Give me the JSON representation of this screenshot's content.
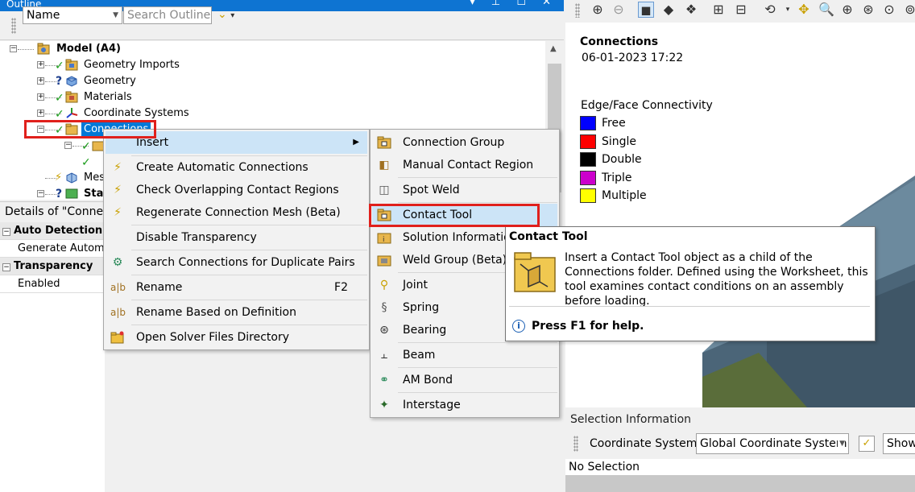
{
  "outline": {
    "title": "Outline",
    "window_buttons": "▾ ⊥ ☐ ✕",
    "name_filter": "Name",
    "search_placeholder": "Search Outline",
    "tree": {
      "model": "Model (A4)",
      "geometry_imports": "Geometry Imports",
      "geometry": "Geometry",
      "materials": "Materials",
      "coordinate_systems": "Coordinate Systems",
      "connections": "Connections",
      "mesh": "Mes",
      "static": "Sta"
    }
  },
  "details": {
    "title": "Details of \"Connec",
    "rows": {
      "auto_detection": "Auto Detection",
      "generate": "Generate Autom",
      "transparency": "Transparency",
      "enabled": "Enabled"
    }
  },
  "context_menu": {
    "insert": "Insert",
    "create_auto": "Create Automatic Connections",
    "check_overlap": "Check Overlapping Contact Regions",
    "regenerate": "Regenerate Connection Mesh (Beta)",
    "disable_transparency": "Disable Transparency",
    "search_duplicates": "Search Connections for Duplicate Pairs",
    "rename": "Rename",
    "rename_shortcut": "F2",
    "rename_definition": "Rename Based on Definition",
    "open_solver": "Open Solver Files Directory"
  },
  "insert_submenu": {
    "connection_group": "Connection Group",
    "manual_contact": "Manual Contact Region",
    "spot_weld": "Spot Weld",
    "contact_tool": "Contact Tool",
    "solution_information": "Solution Informatio",
    "weld_group": "Weld Group (Beta)",
    "joint": "Joint",
    "spring": "Spring",
    "bearing": "Bearing",
    "beam": "Beam",
    "am_bond": "AM Bond",
    "interstage": "Interstage"
  },
  "tooltip": {
    "title": "Contact Tool",
    "body": "Insert a Contact Tool object as a child of the Connections folder. Defined using the Worksheet, this tool examines contact conditions on an assembly before loading.",
    "help": "Press F1 for help."
  },
  "viewport": {
    "title": "Connections",
    "date": "06-01-2023 17:22",
    "legend_title": "Edge/Face Connectivity",
    "legend": [
      {
        "label": "Free",
        "color": "#0000ff"
      },
      {
        "label": "Single",
        "color": "#ff0000"
      },
      {
        "label": "Double",
        "color": "#000000"
      },
      {
        "label": "Triple",
        "color": "#cc00cc"
      },
      {
        "label": "Multiple",
        "color": "#ffff00"
      }
    ]
  },
  "selection": {
    "title": "Selection Information",
    "coord_label": "Coordinate System:",
    "coord_value": "Global Coordinate System",
    "show_label": "Show",
    "no_selection": "No Selection"
  },
  "colors": {
    "title_bar": "#0e74d2",
    "highlight": "#cce4f7",
    "callout": "#e0201c"
  }
}
